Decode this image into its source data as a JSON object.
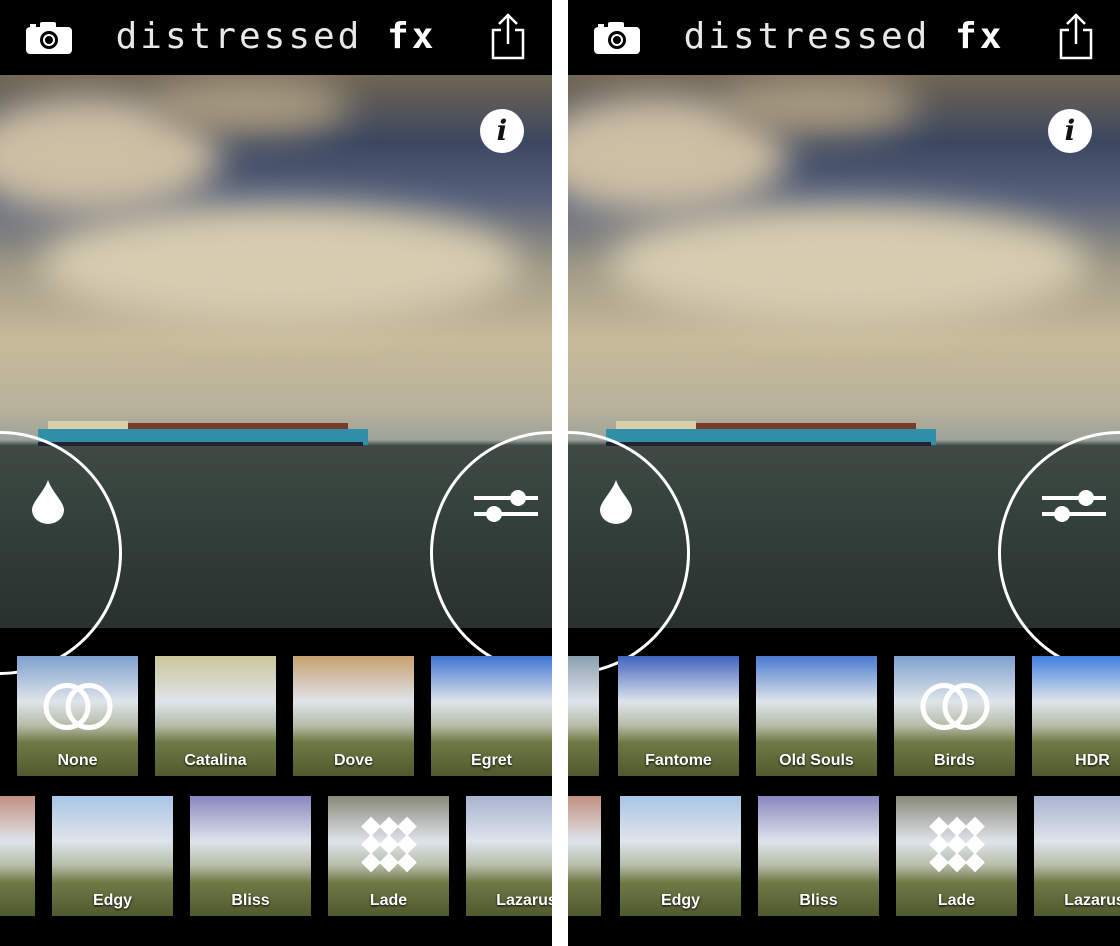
{
  "app": {
    "title_main": "distressed ",
    "title_fx": "fx"
  },
  "icons": {
    "camera": "camera-icon",
    "share": "share-icon",
    "info": "info-icon",
    "drop": "drop-icon",
    "sliders": "sliders-icon"
  },
  "info_label": "i",
  "panels": [
    {
      "row1": [
        {
          "label": "None",
          "overlay": "rings",
          "tint": "#7fa0cf"
        },
        {
          "label": "Catalina",
          "tint": "#c9c79a"
        },
        {
          "label": "Dove",
          "tint": "#c8a070"
        },
        {
          "label": "Egret",
          "tint": "#3f74d0"
        }
      ],
      "row2": [
        {
          "label": "",
          "tint": "#c09080"
        },
        {
          "label": "Edgy",
          "tint": "#a9c6e6"
        },
        {
          "label": "Bliss",
          "tint": "#8a86c0"
        },
        {
          "label": "Lade",
          "overlay": "diamonds",
          "tint": "#8a8a7a"
        },
        {
          "label": "Lazarus",
          "tint": "#a8b4d0"
        }
      ]
    },
    {
      "row1": [
        {
          "label": "",
          "tint": "#8aa0b0"
        },
        {
          "label": "Fantome",
          "tint": "#3f63c0"
        },
        {
          "label": "Old Souls",
          "tint": "#4a7ad0"
        },
        {
          "label": "Birds",
          "overlay": "rings",
          "tint": "#7fa0cf"
        },
        {
          "label": "HDR",
          "tint": "#3f80e0"
        }
      ],
      "row2": [
        {
          "label": "",
          "tint": "#c09080"
        },
        {
          "label": "Edgy",
          "tint": "#a9c6e6"
        },
        {
          "label": "Bliss",
          "tint": "#8a86c0"
        },
        {
          "label": "Lade",
          "overlay": "diamonds",
          "tint": "#8a8a7a"
        },
        {
          "label": "Lazarus",
          "tint": "#a8b4d0"
        }
      ]
    }
  ]
}
